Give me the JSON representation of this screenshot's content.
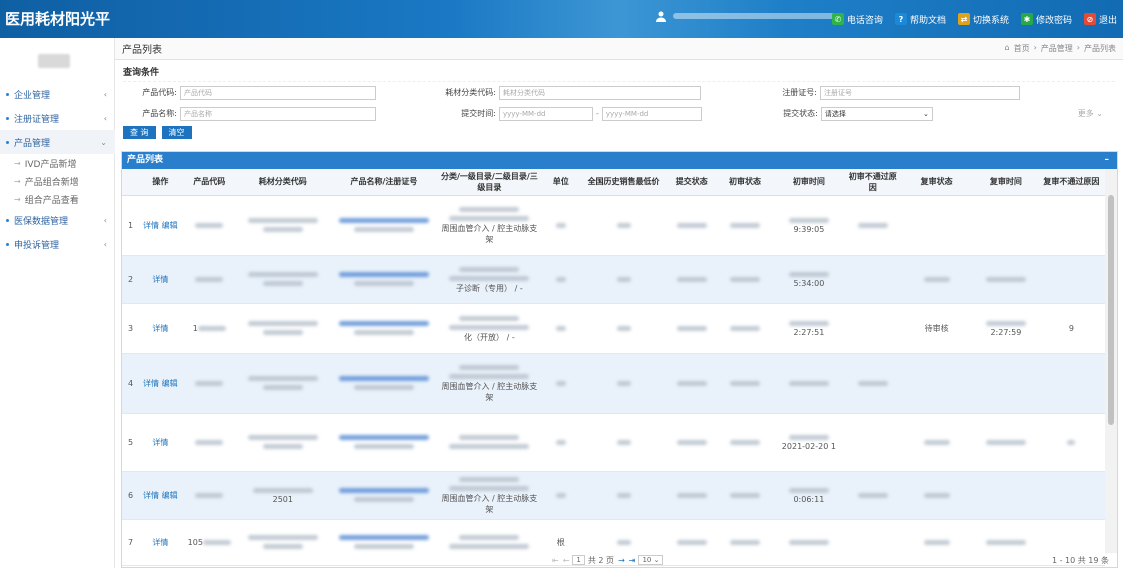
{
  "header": {
    "title": "医用耗材阳光平台",
    "links": [
      {
        "label": "电话咨询",
        "icon": "phone-icon",
        "color": "#2fb34a"
      },
      {
        "label": "帮助文档",
        "icon": "help-icon",
        "color": "#1c88d8"
      },
      {
        "label": "切换系统",
        "icon": "switch-icon",
        "color": "#e0a21a"
      },
      {
        "label": "修改密码",
        "icon": "lock-icon",
        "color": "#29a84a"
      },
      {
        "label": "退出",
        "icon": "logout-icon",
        "color": "#e14b3a"
      }
    ]
  },
  "sidebar": {
    "items": [
      {
        "label": "企业管理"
      },
      {
        "label": "注册证管理"
      },
      {
        "label": "产品管理"
      },
      {
        "label": "医保数据管理"
      },
      {
        "label": "申投诉管理"
      }
    ],
    "subitems": [
      {
        "label": "IVD产品新增"
      },
      {
        "label": "产品组合新增"
      },
      {
        "label": "组合产品查看"
      }
    ]
  },
  "page": {
    "title": "产品列表",
    "breadcrumb": [
      "首页",
      "产品管理",
      "产品列表"
    ]
  },
  "query": {
    "title": "查询条件",
    "code_label": "产品代码:",
    "code_ph": "产品代码",
    "cat_label": "耗材分类代码:",
    "cat_ph": "耗材分类代码",
    "reg_label": "注册证号:",
    "reg_ph": "注册证号",
    "name_label": "产品名称:",
    "name_ph": "产品名称",
    "time_label": "提交时间:",
    "time_from": "yyyy-MM-dd",
    "time_sep": "-",
    "time_to": "yyyy-MM-dd",
    "status_label": "提交状态:",
    "status_value": "请选择",
    "more": "更多",
    "search": "查 询",
    "clear": "清空"
  },
  "table": {
    "title": "产品列表",
    "columns": [
      "操作",
      "产品代码",
      "耗材分类代码",
      "产品名称/注册证号",
      "分类/一级目录/二级目录/三级目录",
      "单位",
      "全国历史销售最低价",
      "提交状态",
      "初审状态",
      "初审时间",
      "初审不通过原因",
      "复审状态",
      "复审时间",
      "复审不通过原因"
    ],
    "rows": [
      {
        "no": "1",
        "ops": "详情 编辑",
        "cls": "周围血管介入 / 腔主动脉支架",
        "t1": "9:39:05",
        "t3": ""
      },
      {
        "no": "2",
        "ops": "详情",
        "cls": "子诊断（专用） / -",
        "t1": "5:34:00",
        "t3": ""
      },
      {
        "no": "3",
        "ops": "详情",
        "code": "1",
        "cls": "化（开放） / -",
        "t1": "2:27:51",
        "s3": "待审核",
        "t3": "2:27:59",
        "x": "9"
      },
      {
        "no": "4",
        "ops": "详情 编辑",
        "cls": "周围血管介入 / 腔主动脉支架",
        "t1": "",
        "t3": ""
      },
      {
        "no": "5",
        "ops": "详情",
        "cls": "",
        "t1": "2021-02-20 1",
        "t3": ""
      },
      {
        "no": "6",
        "ops": "详情 编辑",
        "cat": "2501",
        "cls": "周围血管介入 / 腔主动脉支架",
        "t1": "0:06:11",
        "t3": ""
      },
      {
        "no": "7",
        "ops": "详情",
        "code": "105",
        "cls": "",
        "unit": "根",
        "t1": "",
        "t3": ""
      }
    ]
  },
  "pager": {
    "page": "1",
    "of": "共 2 页",
    "size": "10",
    "range": "1 - 10",
    "total": "共 19 条"
  }
}
